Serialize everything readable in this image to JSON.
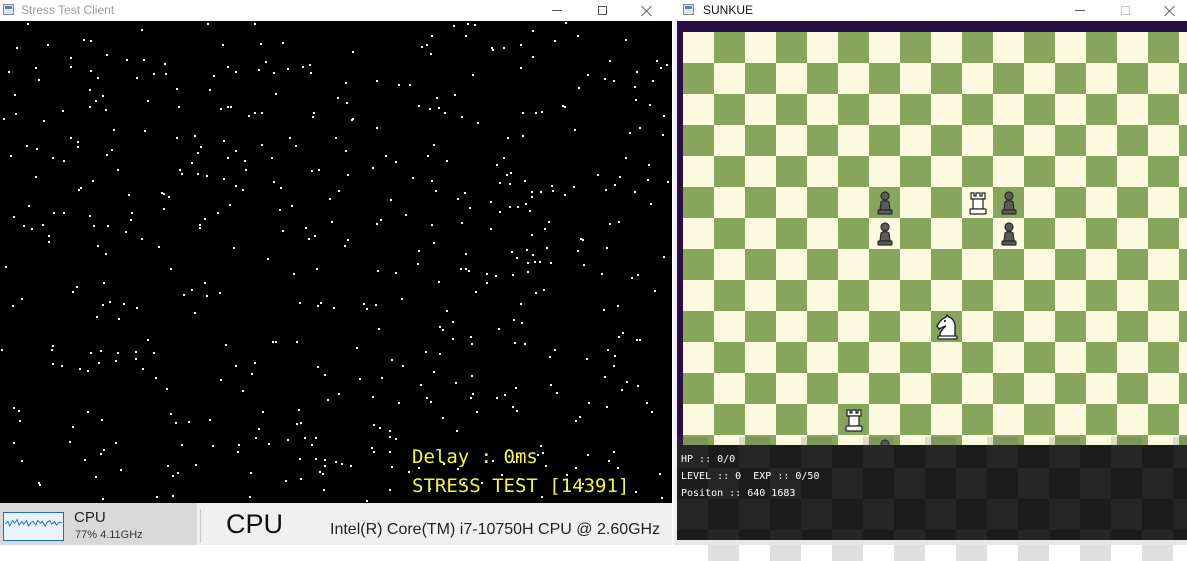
{
  "left_window": {
    "title": "Stress Test Client",
    "icon": "window-app-icon",
    "controls": [
      "minimize-icon",
      "maximize-icon",
      "close-icon"
    ],
    "console": {
      "delay_text": "Delay : 0ms",
      "stress_text": "STRESS TEST [14391]",
      "text_color": "#f5f542",
      "background": "#000000"
    }
  },
  "taskbar": {
    "cpu_tile_label": "CPU",
    "cpu_tile_stats": "77% 4.11GHz",
    "cpu_heading": "CPU",
    "cpu_model": "Intel(R) Core(TM) i7-10750H CPU @ 2.60GHz"
  },
  "right_window": {
    "title": "SUNKUE",
    "icon": "window-app-icon",
    "controls": [
      "minimize-icon",
      "maximize-icon",
      "close-icon"
    ],
    "board": {
      "light_color": "#fbfadf",
      "dark_color": "#88a55e",
      "pieces": [
        {
          "type": "pawn",
          "color": "black",
          "col": 6,
          "row": 5
        },
        {
          "type": "rook",
          "color": "white",
          "col": 9,
          "row": 5
        },
        {
          "type": "pawn",
          "color": "black",
          "col": 10,
          "row": 5
        },
        {
          "type": "pawn",
          "color": "black",
          "col": 6,
          "row": 6
        },
        {
          "type": "pawn",
          "color": "black",
          "col": 10,
          "row": 6
        },
        {
          "type": "knight",
          "color": "white",
          "col": 8,
          "row": 9
        },
        {
          "type": "rook",
          "color": "white",
          "col": 5,
          "row": 12
        },
        {
          "type": "pawn",
          "color": "black",
          "col": 6,
          "row": 13
        }
      ]
    },
    "hud": {
      "hp": "HP :: 0/0",
      "level_exp": "LEVEL :: 0  EXP :: 0/50",
      "position": "Positon :: 640 1683"
    }
  }
}
